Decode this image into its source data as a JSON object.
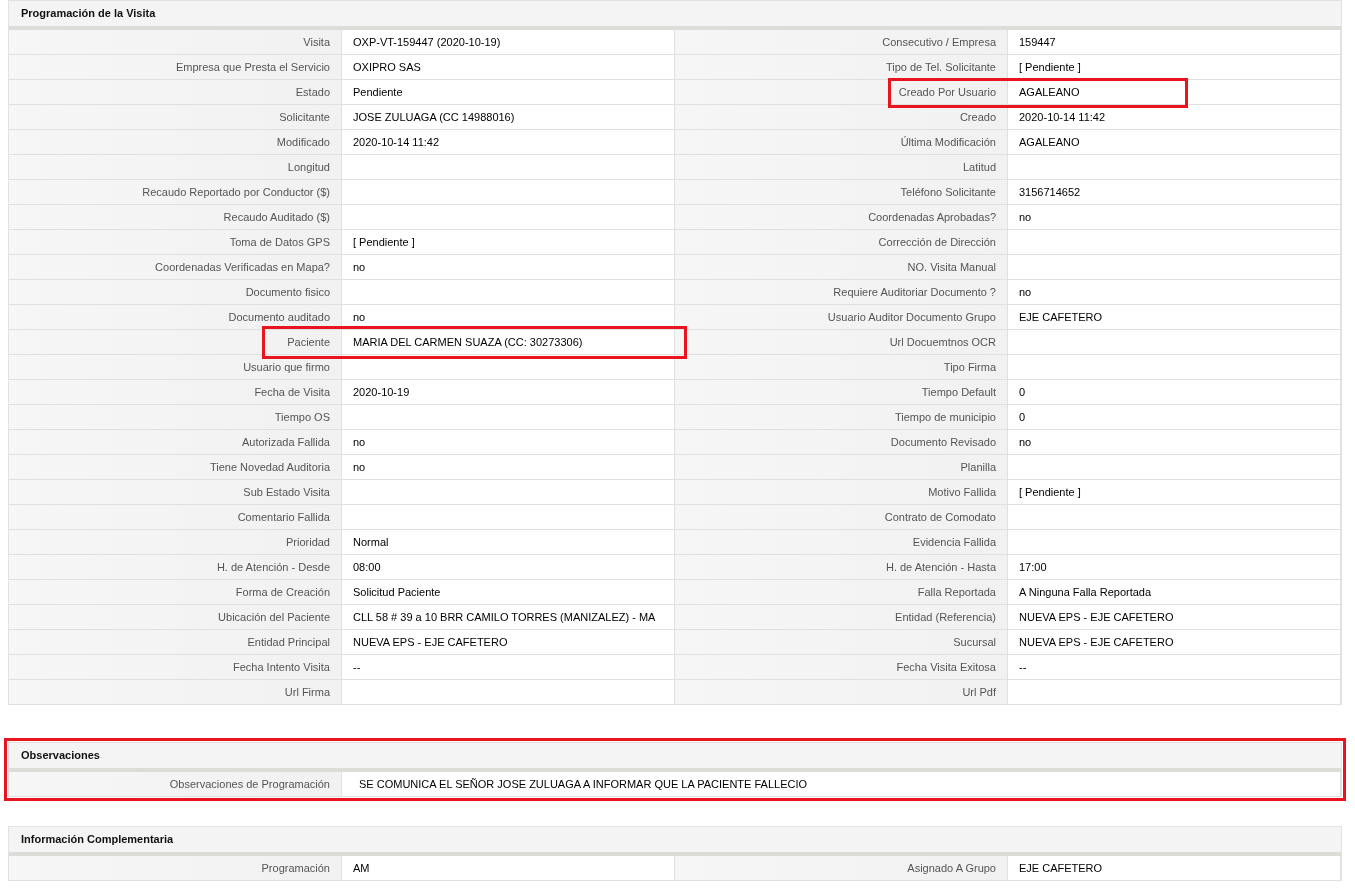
{
  "sections": [
    {
      "title": "Programación de la Visita",
      "kind": "pairs",
      "highlighted": false,
      "fields": [
        {
          "label": "Visita",
          "value": "OXP-VT-159447 (2020-10-19)",
          "highlighted": false
        },
        {
          "label": "Consecutivo / Empresa",
          "value": "159447",
          "highlighted": false
        },
        {
          "label": "Empresa que Presta el Servicio",
          "value": "OXIPRO SAS",
          "highlighted": false
        },
        {
          "label": "Tipo de Tel. Solicitante",
          "value": "[ Pendiente ]",
          "highlighted": false
        },
        {
          "label": "Estado",
          "value": "Pendiente",
          "highlighted": false
        },
        {
          "label": "Creado Por Usuario",
          "value": "AGALEANO",
          "highlighted": true
        },
        {
          "label": "Solicitante",
          "value": "JOSE ZULUAGA (CC 14988016)",
          "highlighted": false
        },
        {
          "label": "Creado",
          "value": "2020-10-14 11:42",
          "highlighted": false
        },
        {
          "label": "Modificado",
          "value": "2020-10-14 11:42",
          "highlighted": false
        },
        {
          "label": "Última Modificación",
          "value": "AGALEANO",
          "highlighted": false
        },
        {
          "label": "Longitud",
          "highlighted": false
        },
        {
          "label": "Latitud",
          "highlighted": false
        },
        {
          "label": "Recaudo Reportado por Conductor ($)",
          "highlighted": false
        },
        {
          "label": "Teléfono Solicitante",
          "value": "3156714652",
          "highlighted": false
        },
        {
          "label": "Recaudo Auditado ($)",
          "highlighted": false
        },
        {
          "label": "Coordenadas Aprobadas?",
          "value": "no",
          "highlighted": false
        },
        {
          "label": "Toma de Datos GPS",
          "value": "[ Pendiente ]",
          "highlighted": false
        },
        {
          "label": "Corrección de Dirección",
          "highlighted": false
        },
        {
          "label": "Coordenadas Verificadas en Mapa?",
          "value": "no",
          "highlighted": false
        },
        {
          "label": "NO. Visita Manual",
          "highlighted": false
        },
        {
          "label": "Documento fisico",
          "highlighted": false
        },
        {
          "label": "Requiere Auditoriar Documento ?",
          "value": "no",
          "highlighted": false
        },
        {
          "label": "Documento auditado",
          "value": "no",
          "highlighted": false
        },
        {
          "label": "Usuario Auditor Documento Grupo",
          "value": "EJE CAFETERO",
          "highlighted": false
        },
        {
          "label": "Paciente",
          "value": "MARIA DEL CARMEN SUAZA (CC: 30273306)",
          "highlighted": true
        },
        {
          "label": "Url Docuemtnos OCR",
          "highlighted": false
        },
        {
          "label": "Usuario que firmo",
          "highlighted": false
        },
        {
          "label": "Tipo Firma",
          "highlighted": false
        },
        {
          "label": "Fecha de Visita",
          "value": "2020-10-19",
          "highlighted": false
        },
        {
          "label": "Tiempo Default",
          "value": "0",
          "highlighted": false
        },
        {
          "label": "Tiempo OS",
          "highlighted": false
        },
        {
          "label": "Tiempo de municipio",
          "value": "0",
          "highlighted": false
        },
        {
          "label": "Autorizada Fallida",
          "value": "no",
          "highlighted": false
        },
        {
          "label": "Documento Revisado",
          "value": "no",
          "highlighted": false
        },
        {
          "label": "Tiene Novedad Auditoria",
          "value": "no",
          "highlighted": false
        },
        {
          "label": "Planilla",
          "highlighted": false
        },
        {
          "label": "Sub Estado Visita",
          "highlighted": false
        },
        {
          "label": "Motivo Fallida",
          "value": "[ Pendiente ]",
          "highlighted": false
        },
        {
          "label": "Comentario Fallida",
          "highlighted": false
        },
        {
          "label": "Contrato de Comodato",
          "highlighted": false
        },
        {
          "label": "Prioridad",
          "value": "Normal",
          "highlighted": false
        },
        {
          "label": "Evidencia Fallida",
          "highlighted": false
        },
        {
          "label": "H. de Atención - Desde",
          "value": "08:00",
          "highlighted": false
        },
        {
          "label": "H. de Atención - Hasta",
          "value": "17:00",
          "highlighted": false
        },
        {
          "label": "Forma de Creación",
          "value": "Solicitud Paciente",
          "highlighted": false
        },
        {
          "label": "Falla Reportada",
          "value": "A Ninguna Falla Reportada",
          "highlighted": false
        },
        {
          "label": "Ubicación del Paciente",
          "value": "CLL 58 # 39 a 10 BRR CAMILO TORRES (MANIZALEZ) - MA",
          "highlighted": false
        },
        {
          "label": "Entidad (Referencia)",
          "value": "NUEVA EPS - EJE CAFETERO",
          "highlighted": false
        },
        {
          "label": "Entidad Principal",
          "value": "NUEVA EPS - EJE CAFETERO",
          "highlighted": false
        },
        {
          "label": "Sucursal",
          "value": "NUEVA EPS - EJE CAFETERO",
          "highlighted": false
        },
        {
          "label": "Fecha Intento Visita",
          "value": "--",
          "highlighted": false
        },
        {
          "label": "Fecha Visita Exitosa",
          "value": "--",
          "highlighted": false
        },
        {
          "label": "Url Firma",
          "highlighted": false
        },
        {
          "label": "Url Pdf",
          "highlighted": false
        }
      ]
    },
    {
      "title": "Observaciones",
      "kind": "full",
      "highlighted": true,
      "fields": [
        {
          "label": "Observaciones de Programación",
          "value": "SE COMUNICA EL SEÑOR JOSE ZULUAGA A INFORMAR QUE LA PACIENTE FALLECIO",
          "highlighted": false
        }
      ]
    },
    {
      "title": "Información Complementaria",
      "kind": "pairs",
      "highlighted": false,
      "fields": [
        {
          "label": "Programación",
          "value": "AM",
          "highlighted": false
        },
        {
          "label": "Asignado A Grupo",
          "value": "EJE CAFETERO",
          "highlighted": false
        }
      ]
    }
  ]
}
